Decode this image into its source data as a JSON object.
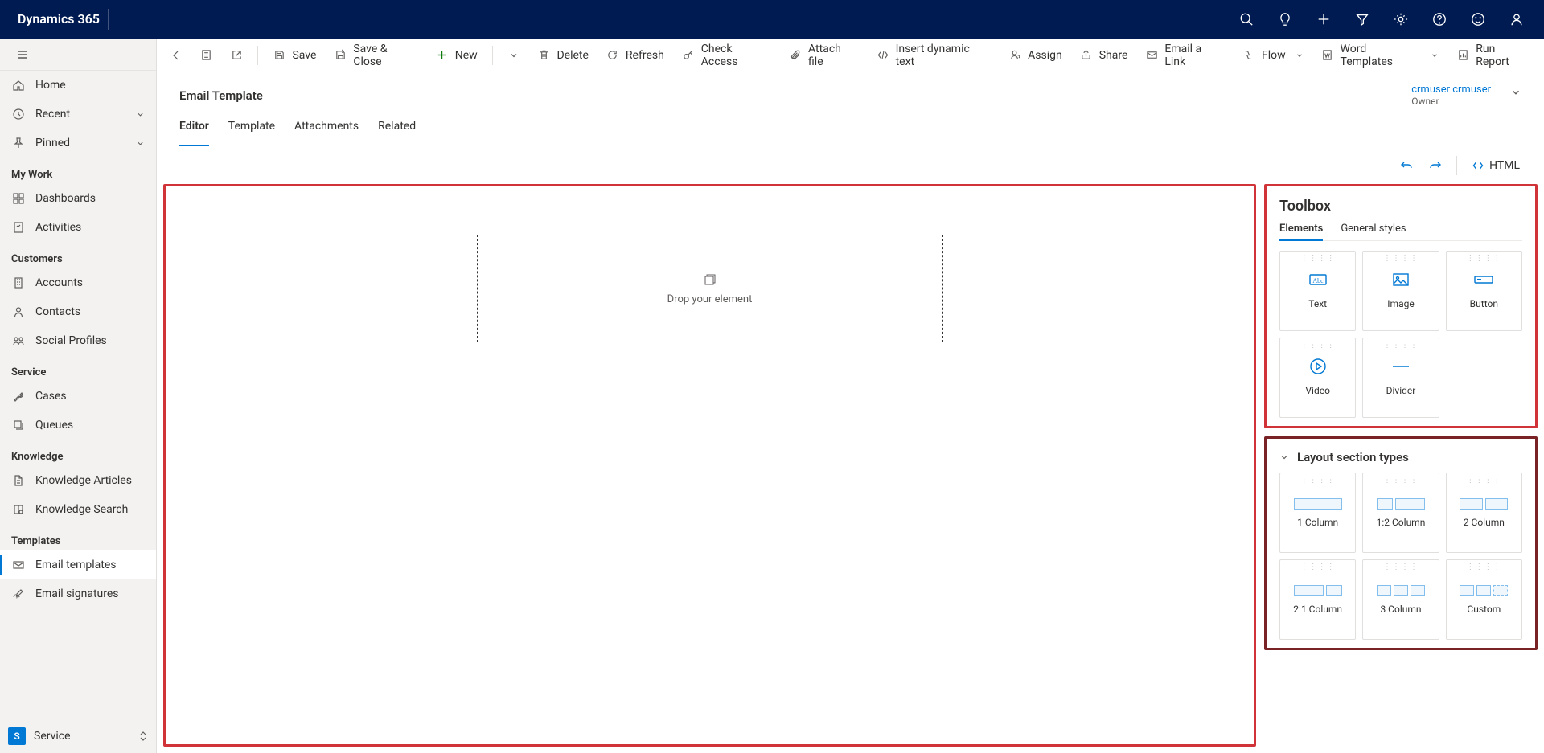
{
  "header": {
    "app_title": "Dynamics 365"
  },
  "sidebar": {
    "nav": [
      {
        "icon": "home-icon",
        "label": "Home",
        "chev": false
      },
      {
        "icon": "clock-icon",
        "label": "Recent",
        "chev": true
      },
      {
        "icon": "pin-icon",
        "label": "Pinned",
        "chev": true
      }
    ],
    "sections": [
      {
        "title": "My Work",
        "items": [
          {
            "icon": "dashboard-icon",
            "label": "Dashboards"
          },
          {
            "icon": "activity-icon",
            "label": "Activities"
          }
        ]
      },
      {
        "title": "Customers",
        "items": [
          {
            "icon": "building-icon",
            "label": "Accounts"
          },
          {
            "icon": "person-icon",
            "label": "Contacts"
          },
          {
            "icon": "social-icon",
            "label": "Social Profiles"
          }
        ]
      },
      {
        "title": "Service",
        "items": [
          {
            "icon": "wrench-icon",
            "label": "Cases"
          },
          {
            "icon": "queue-icon",
            "label": "Queues"
          }
        ]
      },
      {
        "title": "Knowledge",
        "items": [
          {
            "icon": "article-icon",
            "label": "Knowledge Articles"
          },
          {
            "icon": "booksearch-icon",
            "label": "Knowledge Search"
          }
        ]
      },
      {
        "title": "Templates",
        "items": [
          {
            "icon": "emailtmpl-icon",
            "label": "Email templates",
            "active": true
          },
          {
            "icon": "signature-icon",
            "label": "Email signatures"
          }
        ]
      }
    ],
    "footer": {
      "pill": "S",
      "label": "Service"
    }
  },
  "commandbar": {
    "save": "Save",
    "save_close": "Save & Close",
    "new": "New",
    "delete": "Delete",
    "refresh": "Refresh",
    "check_access": "Check Access",
    "attach_file": "Attach file",
    "insert_dynamic": "Insert dynamic text",
    "assign": "Assign",
    "share": "Share",
    "email_link": "Email a Link",
    "flow": "Flow",
    "word_templates": "Word Templates",
    "run_report": "Run Report"
  },
  "form": {
    "title": "Email Template",
    "owner_name": "crmuser crmuser",
    "owner_label": "Owner",
    "tabs": [
      "Editor",
      "Template",
      "Attachments",
      "Related"
    ],
    "active_tab": 0
  },
  "editbar": {
    "html": "HTML"
  },
  "canvas": {
    "drop_text": "Drop your element"
  },
  "toolbox": {
    "title": "Toolbox",
    "tabs": [
      "Elements",
      "General styles"
    ],
    "elements": [
      {
        "label": "Text",
        "icon": "text"
      },
      {
        "label": "Image",
        "icon": "image"
      },
      {
        "label": "Button",
        "icon": "button"
      },
      {
        "label": "Video",
        "icon": "video"
      },
      {
        "label": "Divider",
        "icon": "divider"
      }
    ],
    "layout_title": "Layout section types",
    "layouts": [
      {
        "label": "1 Column",
        "type": "one"
      },
      {
        "label": "1:2 Column",
        "type": "onetwo"
      },
      {
        "label": "2 Column",
        "type": "two"
      },
      {
        "label": "2:1 Column",
        "type": "twoone"
      },
      {
        "label": "3 Column",
        "type": "three"
      },
      {
        "label": "Custom",
        "type": "custom"
      }
    ]
  }
}
